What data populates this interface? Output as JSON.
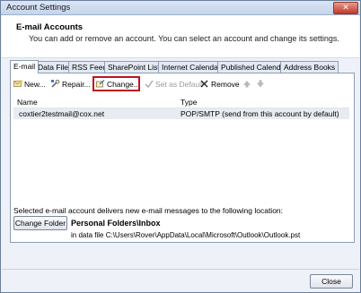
{
  "window": {
    "title": "Account Settings",
    "close_glyph": "✕"
  },
  "header": {
    "title": "E-mail Accounts",
    "subtitle": "You can add or remove an account. You can select an account and change its settings."
  },
  "tabs": [
    {
      "label": "E-mail",
      "active": true
    },
    {
      "label": "Data Files"
    },
    {
      "label": "RSS Feeds"
    },
    {
      "label": "SharePoint Lists"
    },
    {
      "label": "Internet Calendars"
    },
    {
      "label": "Published Calendars"
    },
    {
      "label": "Address Books"
    }
  ],
  "toolbar": {
    "new_label": "New...",
    "repair_label": "Repair...",
    "change_label": "Change...",
    "set_default_label": "Set as Default",
    "remove_label": "Remove"
  },
  "list": {
    "columns": [
      "Name",
      "Type"
    ],
    "rows": [
      {
        "name": "coxtier2testmail@cox.net",
        "type": "POP/SMTP (send from this account by default)"
      }
    ]
  },
  "delivery": {
    "text": "Selected e-mail account delivers new e-mail messages to the following location:",
    "change_folder_label": "Change Folder",
    "folder_path": "Personal Folders\\Inbox",
    "data_file": "in data file C:\\Users\\Rover\\AppData\\Local\\Microsoft\\Outlook\\Outlook.pst"
  },
  "footer": {
    "close_label": "Close"
  }
}
